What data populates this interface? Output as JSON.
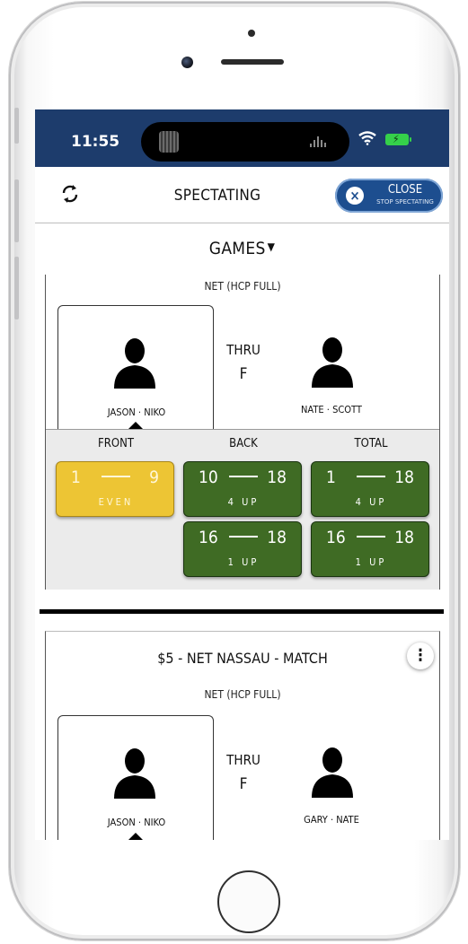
{
  "status_bar": {
    "time": "11:55"
  },
  "header": {
    "title": "SPECTATING",
    "close_label": "CLOSE",
    "close_sublabel": "STOP SPECTATING"
  },
  "section": {
    "title": "GAMES"
  },
  "games": [
    {
      "handicap": "NET (HCP FULL)",
      "team1": "JASON · NIKO",
      "team2": "NATE · SCOTT",
      "thru_label": "THRU",
      "thru_value": "F",
      "columns": [
        "FRONT",
        "BACK",
        "TOTAL"
      ],
      "segments": {
        "front": {
          "from": "1",
          "to": "9",
          "status": "EVEN",
          "color": "yellow"
        },
        "back": [
          {
            "from": "10",
            "to": "18",
            "status": "4 UP",
            "color": "green"
          },
          {
            "from": "16",
            "to": "18",
            "status": "1 UP",
            "color": "green"
          }
        ],
        "total": [
          {
            "from": "1",
            "to": "18",
            "status": "4 UP",
            "color": "green"
          },
          {
            "from": "16",
            "to": "18",
            "status": "1 UP",
            "color": "green"
          }
        ]
      }
    },
    {
      "title": "$5 - NET NASSAU - MATCH",
      "handicap": "NET (HCP FULL)",
      "team1": "JASON · NIKO",
      "team2": "GARY · NATE",
      "thru_label": "THRU",
      "thru_value": "F"
    }
  ],
  "colors": {
    "navy": "#1d3c6c",
    "green": "#3f6b24",
    "yellow": "#edc534",
    "close_button": "#1d4e8f"
  },
  "icons": [
    "refresh-icon",
    "close-icon",
    "caret-down-icon",
    "person-icon",
    "more-vertical-icon",
    "wifi-icon",
    "battery-icon"
  ]
}
